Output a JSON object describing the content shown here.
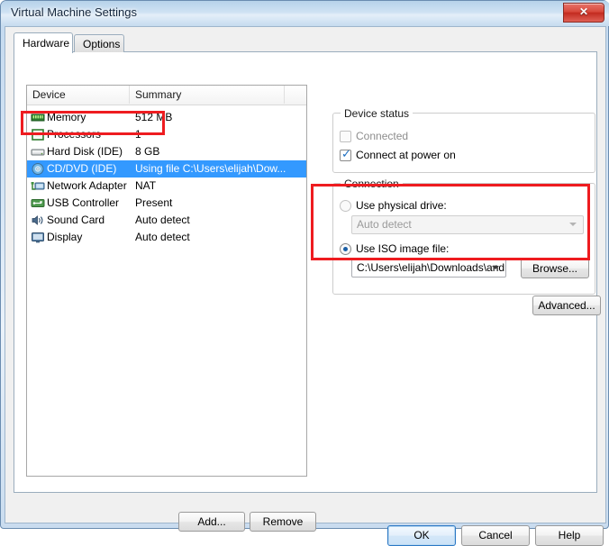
{
  "window": {
    "title": "Virtual Machine Settings",
    "close_label": "✕",
    "close_icon": "close-icon"
  },
  "tabs": [
    {
      "label": "Hardware",
      "active": true
    },
    {
      "label": "Options",
      "active": false
    }
  ],
  "device_list": {
    "columns": [
      "Device",
      "Summary",
      ""
    ],
    "rows": [
      {
        "icon": "memory-icon",
        "device": "Memory",
        "summary": "512 MB",
        "selected": false
      },
      {
        "icon": "processor-icon",
        "device": "Processors",
        "summary": "1",
        "selected": false
      },
      {
        "icon": "hard-disk-icon",
        "device": "Hard Disk (IDE)",
        "summary": "8 GB",
        "selected": false
      },
      {
        "icon": "cd-dvd-icon",
        "device": "CD/DVD (IDE)",
        "summary": "Using file C:\\Users\\elijah\\Dow...",
        "selected": true
      },
      {
        "icon": "network-adapter-icon",
        "device": "Network Adapter",
        "summary": "NAT",
        "selected": false
      },
      {
        "icon": "usb-controller-icon",
        "device": "USB Controller",
        "summary": "Present",
        "selected": false
      },
      {
        "icon": "sound-card-icon",
        "device": "Sound Card",
        "summary": "Auto detect",
        "selected": false
      },
      {
        "icon": "display-icon",
        "device": "Display",
        "summary": "Auto detect",
        "selected": false
      }
    ]
  },
  "list_buttons": {
    "add_label": "Add...",
    "remove_label": "Remove"
  },
  "device_status": {
    "legend": "Device status",
    "connected": {
      "label": "Connected",
      "checked": false,
      "enabled": false
    },
    "connect_at_power_on": {
      "label": "Connect at power on",
      "checked": true,
      "enabled": true
    }
  },
  "connection": {
    "legend": "Connection",
    "use_physical_drive": {
      "label": "Use physical drive:",
      "selected": false
    },
    "physical_drive_value": "Auto detect",
    "use_iso_image_file": {
      "label": "Use ISO image file:",
      "selected": true
    },
    "iso_path_value": "C:\\Users\\elijah\\Downloads\\andr",
    "browse_label": "Browse...",
    "advanced_label": "Advanced..."
  },
  "dialog_buttons": {
    "ok_label": "OK",
    "cancel_label": "Cancel",
    "help_label": "Help"
  },
  "annotations": {
    "color": "#ee1c20",
    "boxes": [
      {
        "name": "hard-disk-row-highlight"
      },
      {
        "name": "iso-image-section-highlight"
      }
    ]
  },
  "colors": {
    "selection_blue": "#3399ff",
    "title_bar": "#cfe2f3",
    "dialog_bg": "#f0f0f0",
    "annotation_red": "#ee1c20"
  }
}
